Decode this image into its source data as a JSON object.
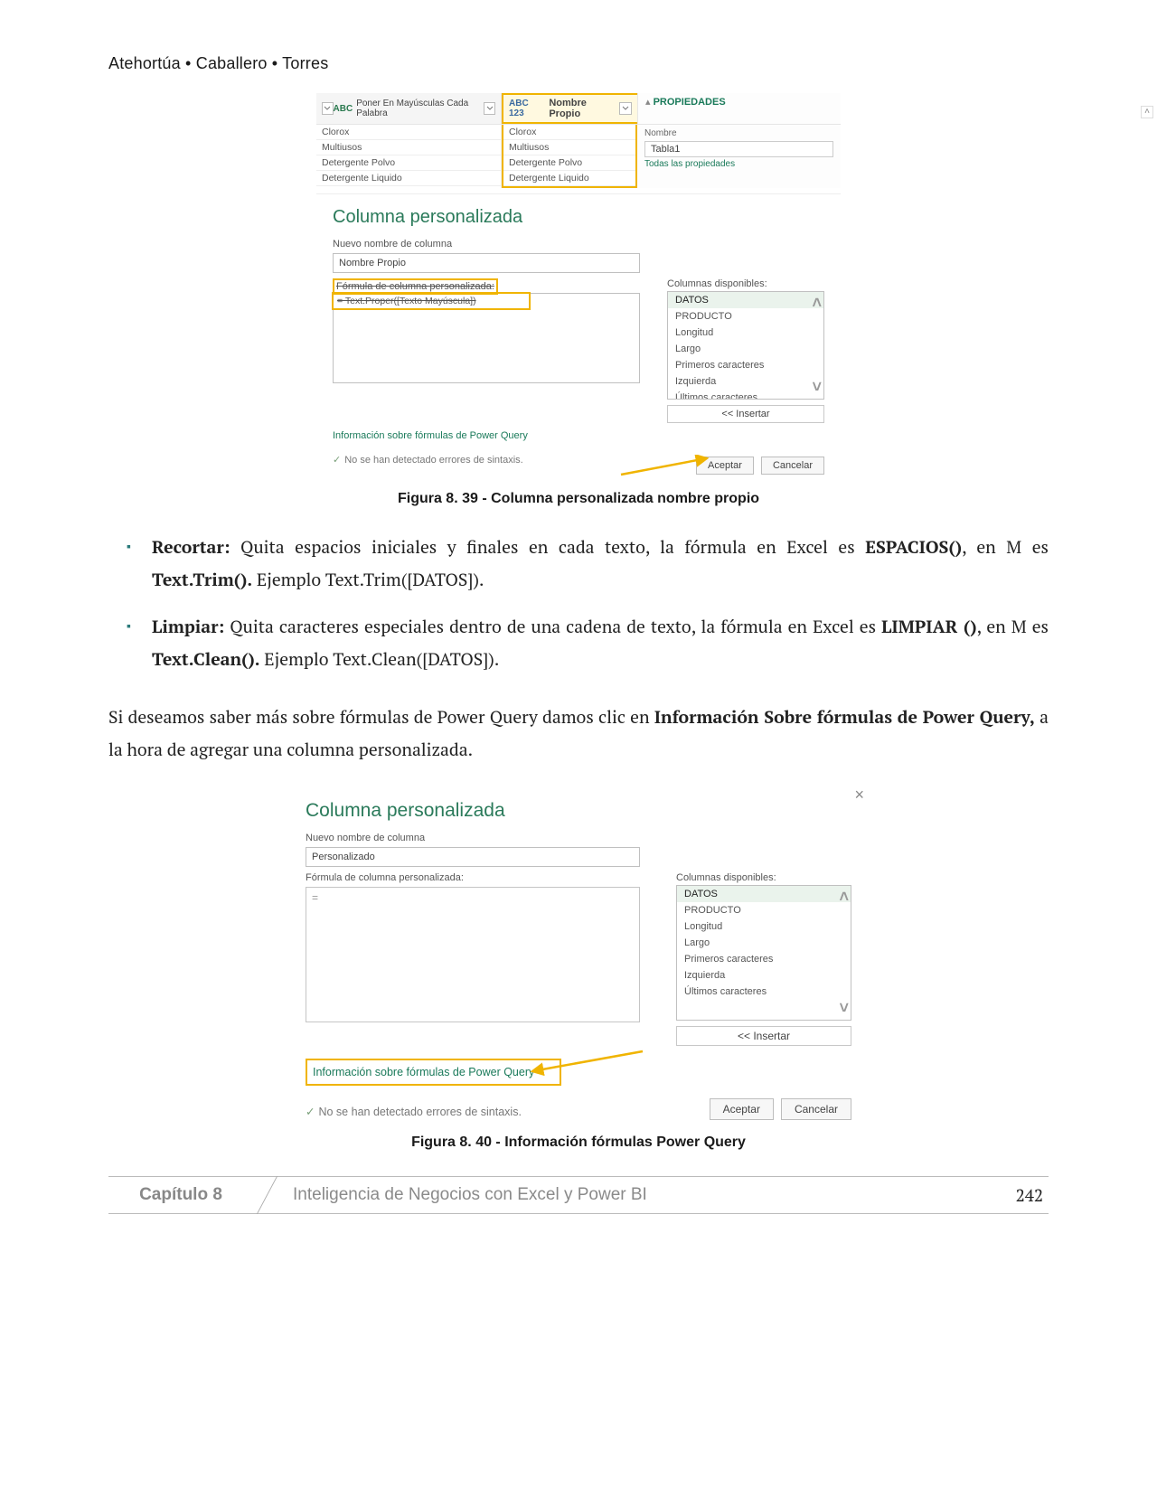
{
  "running_head": "Atehortúa • Caballero • Torres",
  "fig39": {
    "col1_header": "Poner En Mayúsculas Cada Palabra",
    "col2_header": "Nombre Propio",
    "type_abc": "ABC",
    "type_123": "ABC 123",
    "rows_left": [
      "Clorox",
      "Multiusos",
      "Detergente Polvo",
      "Detergente Liquido"
    ],
    "rows_right": [
      "Clorox",
      "Multiusos",
      "Detergente Polvo",
      "Detergente Liquido"
    ],
    "props_title": "PROPIEDADES",
    "props_name_label": "Nombre",
    "props_name_value": "Tabla1",
    "props_link": "Todas las propiedades",
    "dialog_title": "Columna personalizada",
    "new_col_label": "Nuevo nombre de columna",
    "new_col_value": "Nombre Propio",
    "formula_label": "Fórmula de columna personalizada:",
    "formula_value": "= Text.Proper([Texto Mayúscula])",
    "avail_label": "Columnas disponibles:",
    "avail_items": [
      "DATOS",
      "PRODUCTO",
      "Longitud",
      "Largo",
      "Primeros caracteres",
      "Izquierda",
      "Últimos caracteres"
    ],
    "insert_btn": "<< Insertar",
    "info_link": "Información sobre fórmulas de Power Query",
    "status": "No se han detectado errores de sintaxis.",
    "ok": "Aceptar",
    "cancel": "Cancelar",
    "caption": "Figura 8. 39 - Columna personalizada nombre propio"
  },
  "bullets": {
    "b1_label": "Recortar:",
    "b1_text_a": " Quita espacios iniciales y finales en cada texto, la fórmula en Excel es ",
    "b1_bold_a": "ESPACIOS()",
    "b1_text_b": ", en M es ",
    "b1_bold_b": "Text.Trim().",
    "b1_text_c": " Ejemplo Text.Trim([DATOS]).",
    "b2_label": "Limpiar:",
    "b2_text_a": " Quita caracteres especiales dentro de una cadena de texto, la fórmula en Excel es ",
    "b2_bold_a": "LIMPIAR ()",
    "b2_text_b": ", en M es ",
    "b2_bold_b": "Text.Clean().",
    "b2_text_c": " Ejemplo Text.Clean([DATOS])."
  },
  "para": {
    "a": "Si deseamos saber más sobre fórmulas de Power Query damos clic en ",
    "bold": "Información Sobre fórmulas de Power Query,",
    "c": "  a la hora de agregar una columna personalizada."
  },
  "fig40": {
    "dialog_title": "Columna personalizada",
    "new_col_label": "Nuevo nombre de columna",
    "new_col_value": "Personalizado",
    "formula_label": "Fórmula de columna personalizada:",
    "formula_value": "=",
    "avail_label": "Columnas disponibles:",
    "avail_items": [
      "DATOS",
      "PRODUCTO",
      "Longitud",
      "Largo",
      "Primeros caracteres",
      "Izquierda",
      "Últimos caracteres"
    ],
    "insert_btn": "<< Insertar",
    "info_link": "Información sobre fórmulas de Power Query",
    "status": "No se han detectado errores de sintaxis.",
    "ok": "Aceptar",
    "cancel": "Cancelar",
    "caption": "Figura 8. 40 - Información fórmulas Power Query"
  },
  "footer": {
    "chapter": "Capítulo 8",
    "title": "Inteligencia de Negocios con Excel y Power BI",
    "page": "242"
  }
}
